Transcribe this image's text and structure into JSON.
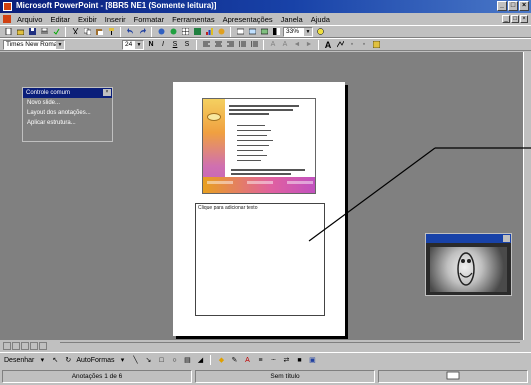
{
  "window": {
    "title": "Microsoft PowerPoint - [8BR5 NE1 (Somente leitura)]",
    "controls": [
      "_",
      "□",
      "×"
    ]
  },
  "menubar": {
    "items": [
      "Arquivo",
      "Editar",
      "Exibir",
      "Inserir",
      "Formatar",
      "Ferramentas",
      "Apresentações",
      "Janela",
      "Ajuda"
    ]
  },
  "toolbar_standard": {
    "zoom": "33%"
  },
  "toolbar_format": {
    "font": "Times New Roman",
    "size": "24"
  },
  "floating_menu": {
    "title": "Controle comum",
    "items": [
      "Novo slide...",
      "Layout dos anotações...",
      "Aplicar estrutura..."
    ]
  },
  "notes_page": {
    "notes_text": "Clique para adicionar texto"
  },
  "drawing_toolbar": {
    "draw_label": "Desenhar",
    "autoshapes_label": "AutoFormas"
  },
  "statusbar": {
    "view": "Anotações 1 de 6",
    "template": "Sem título"
  },
  "colors": {
    "titlebar": "#0a1e7a",
    "workspace": "#808080",
    "chrome": "#c0c0c0"
  }
}
